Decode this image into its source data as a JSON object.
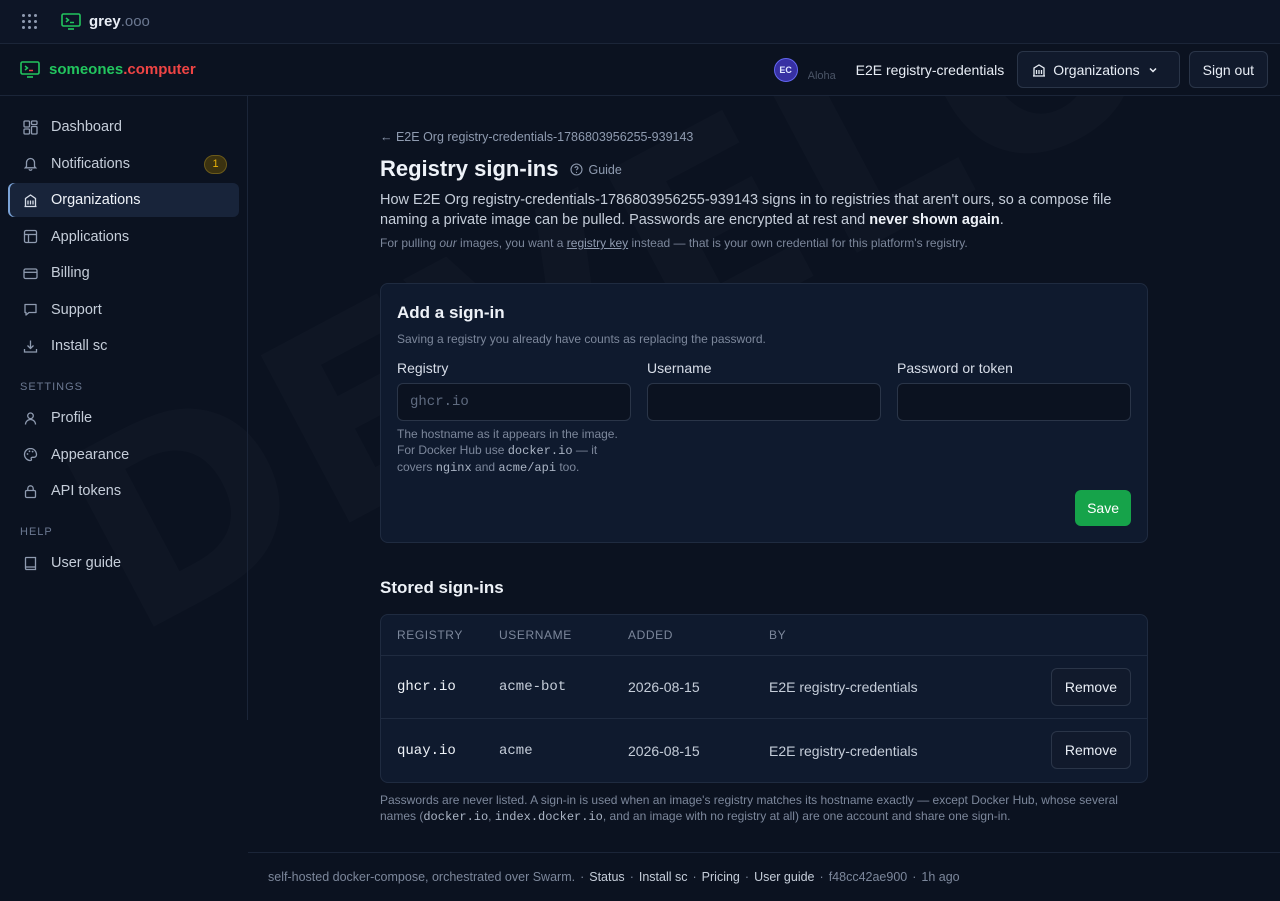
{
  "watermark": "DEVELOPMENT",
  "topbar": {
    "brand": "grey",
    "brand_suffix": ".ooo"
  },
  "appbar": {
    "logo_part1": "someones",
    "logo_part2": ".computer",
    "avatar_initials": "EC",
    "avatar_name": "Aloha",
    "user_name": "E2E registry-credentials",
    "org_button": "Organizations",
    "signout_button": "Sign out"
  },
  "sidebar": {
    "items": [
      {
        "label": "Dashboard"
      },
      {
        "label": "Notifications",
        "badge": "1"
      },
      {
        "label": "Organizations"
      },
      {
        "label": "Applications"
      },
      {
        "label": "Billing"
      },
      {
        "label": "Support"
      },
      {
        "label": "Install sc"
      }
    ],
    "settings_heading": "SETTINGS",
    "settings_items": [
      {
        "label": "Profile"
      },
      {
        "label": "Appearance"
      },
      {
        "label": "API tokens"
      }
    ],
    "help_heading": "HELP",
    "help_items": [
      {
        "label": "User guide"
      }
    ]
  },
  "page": {
    "back_link": "← E2E Org registry-credentials-1786803956255-939143",
    "title": "Registry sign-ins",
    "guide": "Guide",
    "desc_main": "How E2E Org registry-credentials-1786803956255-939143 signs in to registries that aren't ours, so a compose file naming a private image can be pulled. Passwords are encrypted at rest and ",
    "desc_bold": "never shown again",
    "desc_end": ".",
    "sub_prefix": "For pulling ",
    "sub_our": "our",
    "sub_middle": " images, you want a ",
    "sub_link": "registry key",
    "sub_suffix": " instead — that is your own credential for this platform's registry."
  },
  "form": {
    "title": "Add a sign-in",
    "subtitle": "Saving a registry you already have counts as replacing the password.",
    "registry_label": "Registry",
    "registry_placeholder": "ghcr.io",
    "registry_value": "",
    "username_label": "Username",
    "username_value": "",
    "password_label": "Password or token",
    "password_value": "",
    "help_1": "The hostname as it appears in the image. For Docker Hub use ",
    "help_code1": "docker.io",
    "help_2": " — it covers ",
    "help_code2": "nginx",
    "help_3": " and ",
    "help_code3": "acme/api",
    "help_4": " too.",
    "save_button": "Save"
  },
  "stored": {
    "title": "Stored sign-ins",
    "columns": [
      "REGISTRY",
      "USERNAME",
      "ADDED",
      "BY"
    ],
    "rows": [
      {
        "registry": "ghcr.io",
        "username": "acme-bot",
        "added": "2026-08-15",
        "by": "E2E registry-credentials",
        "action": "Remove"
      },
      {
        "registry": "quay.io",
        "username": "acme",
        "added": "2026-08-15",
        "by": "E2E registry-credentials",
        "action": "Remove"
      }
    ],
    "note_1": "Passwords are never listed. A sign-in is used when an image's registry matches its hostname exactly — except Docker Hub, whose several names (",
    "note_code1": "docker.io",
    "note_2": ", ",
    "note_code2": "index.docker.io",
    "note_3": ", and an image with no registry at all) are one account and share one sign-in."
  },
  "footer": {
    "text": "self-hosted docker-compose, orchestrated over Swarm.",
    "sep": "·",
    "links": [
      "Status",
      "Install sc",
      "Pricing",
      "User guide"
    ],
    "commit": "f48cc42ae900",
    "time": "1h ago"
  },
  "colors": {
    "accent_green": "#22c55e",
    "accent_red": "#ef4444",
    "save_green": "#16a34a",
    "badge_yellow": "#eab308"
  }
}
